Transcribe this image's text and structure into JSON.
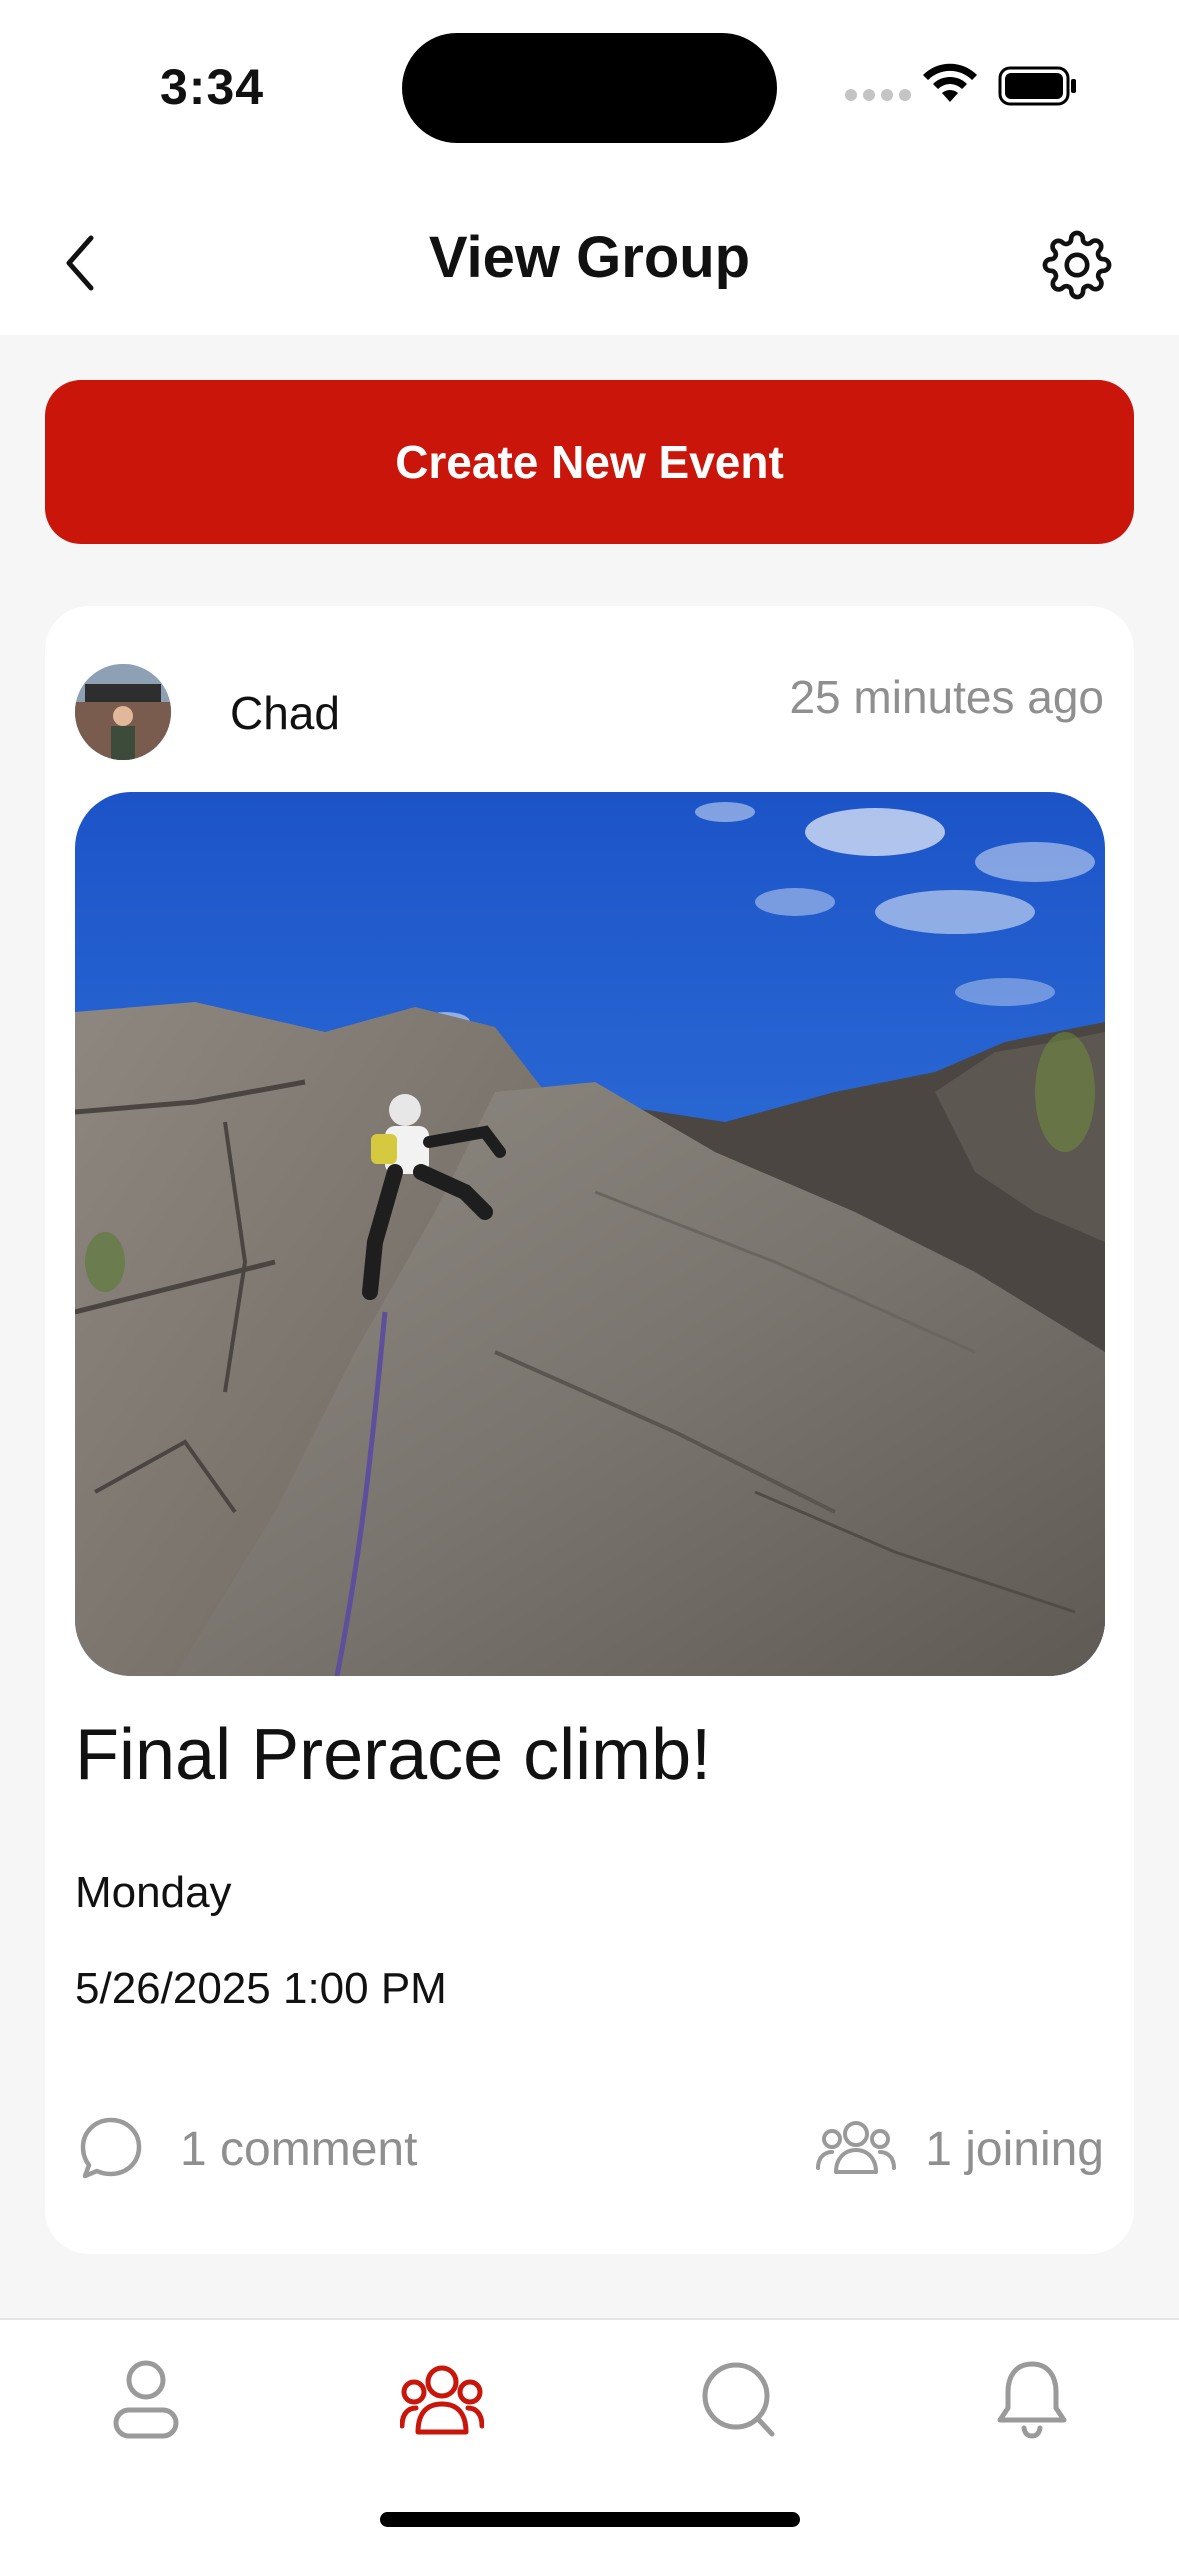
{
  "status_bar": {
    "time": "3:34"
  },
  "nav": {
    "title": "View Group",
    "back_icon": "chevron-left-icon",
    "settings_icon": "gear-icon"
  },
  "create_button": {
    "label": "Create New Event",
    "color": "#c9150a"
  },
  "event_card": {
    "author": "Chad",
    "time_ago": "25 minutes ago",
    "title": "Final Prerace climb!",
    "day": "Monday",
    "datetime": "5/26/2025 1:00 PM",
    "comments": "1 comment",
    "joining": "1 joining"
  },
  "tab_bar": {
    "items": [
      {
        "name": "profile",
        "icon": "person-icon",
        "active": false
      },
      {
        "name": "groups",
        "icon": "group-icon",
        "active": true
      },
      {
        "name": "search",
        "icon": "search-icon",
        "active": false
      },
      {
        "name": "notifications",
        "icon": "bell-icon",
        "active": false
      }
    ],
    "active_color": "#c9150a",
    "inactive_color": "#9a9a9a"
  }
}
